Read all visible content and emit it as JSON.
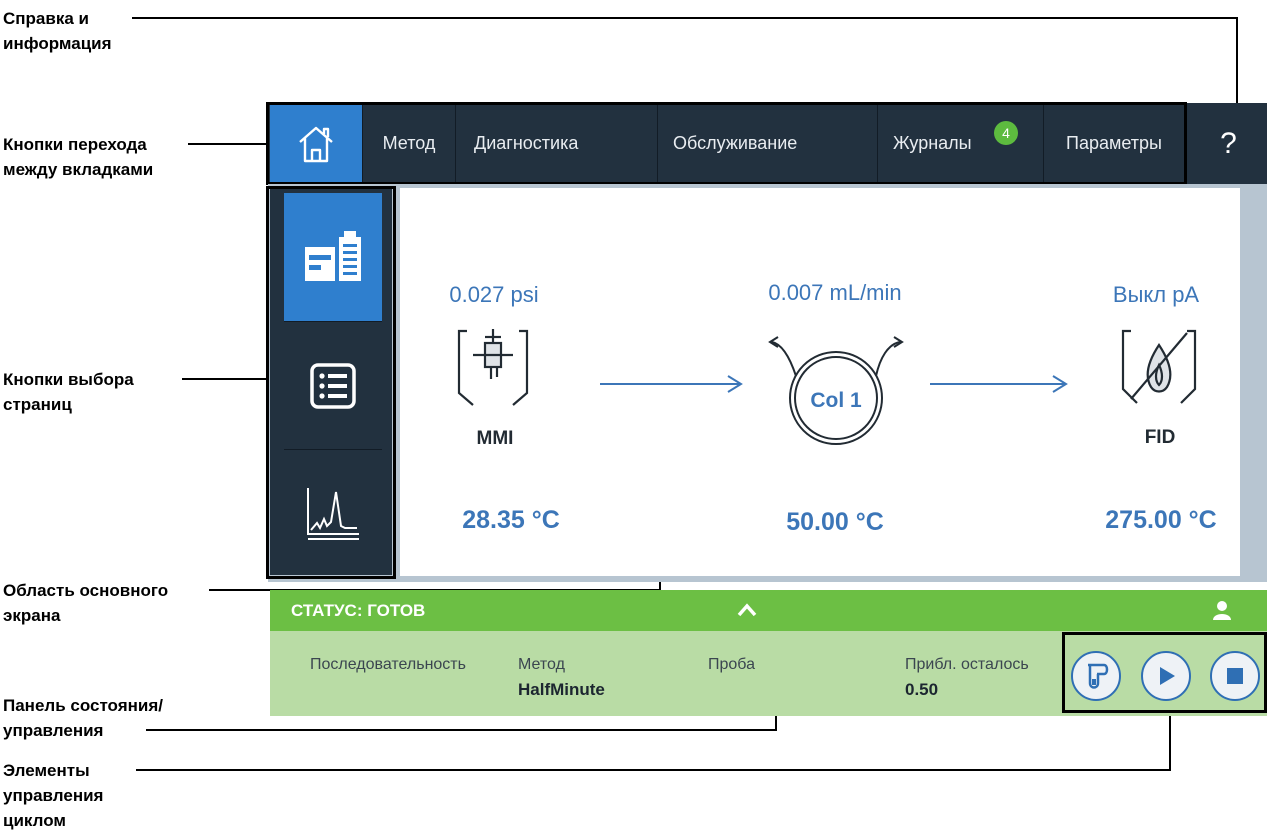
{
  "callouts": {
    "help": "Справка и\nинформация",
    "tabs": "Кнопки перехода\nмежду вкладками",
    "pages": "Кнопки выбора\nстраниц",
    "main_area": "Область основного\nэкрана",
    "status_panel": "Панель состояния/\nуправления",
    "run_controls": "Элементы\nуправления\nциклом"
  },
  "tabs": [
    {
      "id": "home",
      "label": "",
      "icon": "home-icon"
    },
    {
      "id": "method",
      "label": "Метод"
    },
    {
      "id": "diagnostics",
      "label": "Диагностика"
    },
    {
      "id": "maintenance",
      "label": "Обслуживание"
    },
    {
      "id": "logs",
      "label": "Журналы",
      "badge": "4"
    },
    {
      "id": "settings",
      "label": "Параметры"
    }
  ],
  "help_label": "?",
  "side_pages": [
    {
      "icon": "instrument-status-icon",
      "active": true
    },
    {
      "icon": "list-icon",
      "active": false
    },
    {
      "icon": "chromatogram-icon",
      "active": false
    }
  ],
  "flow": {
    "inlet": {
      "label": "MMI",
      "value": "0.027 psi",
      "temp": "28.35 °C"
    },
    "column": {
      "label": "Col 1",
      "value": "0.007 mL/min",
      "temp": "50.00 °C"
    },
    "detector": {
      "label": "FID",
      "value": "Выкл pA",
      "temp": "275.00 °C"
    }
  },
  "status": {
    "title": "СТАТУС: ГОТОВ",
    "sequence_label": "Последовательность",
    "method_label": "Метод",
    "method_value": "HalfMinute",
    "sample_label": "Проба",
    "remaining_label": "Прибл. осталось",
    "remaining_value": "0.50"
  },
  "colors": {
    "tabbar": "#22313f",
    "accent_blue": "#2f7fce",
    "value_blue": "#3c76b8",
    "status_green": "#6cbf44",
    "status_light": "#b9dca5",
    "badge_green": "#5dbb3f"
  }
}
